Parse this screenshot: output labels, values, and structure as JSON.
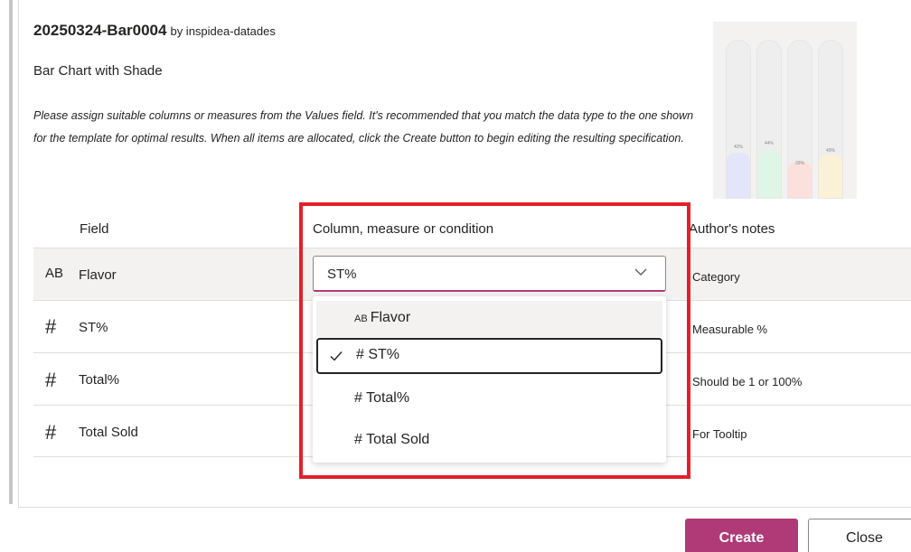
{
  "header": {
    "title": "20250324-Bar0004",
    "author": "by inspidea-datades",
    "subtitle": "Bar Chart with Shade",
    "description": "Please assign suitable columns or measures from the Values field. It's recommended that you match the data type to the one shown for the template for optimal results. When all items are allocated, click the Create button to begin editing the resulting specification."
  },
  "thumbnail": {
    "labels": [
      "42%",
      "44%",
      "33%",
      "40%"
    ],
    "fractions": [
      0.42,
      0.44,
      0.33,
      0.4
    ],
    "colors": [
      "#e3e6fa",
      "#dff5e6",
      "#fbe0dc",
      "#fbf1d6"
    ]
  },
  "table": {
    "headers": {
      "field": "Field",
      "column": "Column, measure or condition",
      "notes": "Author's notes"
    },
    "rows": [
      {
        "icon": "AB",
        "field": "Flavor",
        "note": "Category"
      },
      {
        "icon": "#",
        "field": "ST%",
        "note": "Measurable %"
      },
      {
        "icon": "#",
        "field": "Total%",
        "note": "Should be 1 or 100%"
      },
      {
        "icon": "#",
        "field": "Total Sold",
        "note": "For Tooltip"
      }
    ]
  },
  "select": {
    "value": "ST%",
    "options": [
      {
        "prefix": "AB",
        "label": "Flavor"
      },
      {
        "prefix": "#",
        "label": "ST%"
      },
      {
        "prefix": "#",
        "label": "Total%"
      },
      {
        "prefix": "#",
        "label": "Total Sold"
      }
    ]
  },
  "buttons": {
    "create": "Create",
    "close": "Close"
  },
  "colors": {
    "accent": "#b03a78",
    "highlight": "#e3202a"
  }
}
